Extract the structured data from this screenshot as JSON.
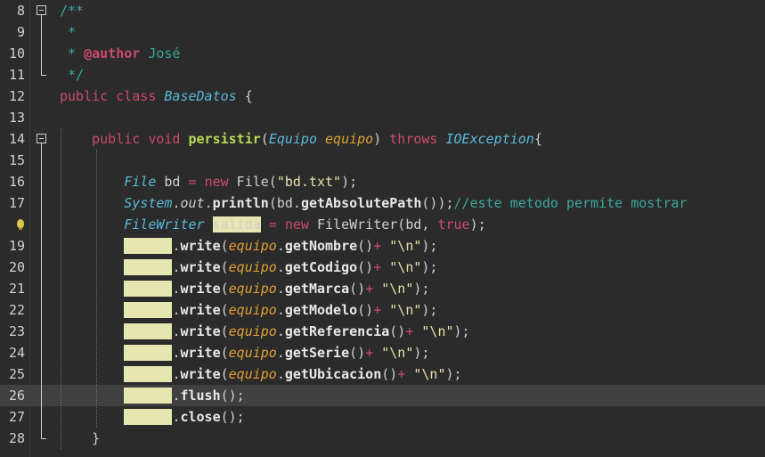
{
  "lines": [
    {
      "n": "8",
      "parts": [
        [
          "cm",
          "/**"
        ]
      ]
    },
    {
      "n": "9",
      "parts": [
        [
          "cm",
          " *"
        ]
      ]
    },
    {
      "n": "10",
      "parts": [
        [
          "cm",
          " * "
        ],
        [
          "tag",
          "@author"
        ],
        [
          "cm",
          " José"
        ]
      ]
    },
    {
      "n": "11",
      "parts": [
        [
          "cm",
          " */"
        ]
      ]
    },
    {
      "n": "12",
      "parts": [
        [
          "kw",
          "public class "
        ],
        [
          "ty",
          "BaseDatos"
        ],
        [
          "cls",
          " {"
        ]
      ]
    },
    {
      "n": "13",
      "parts": []
    },
    {
      "n": "14",
      "parts": [
        [
          "cls",
          "    "
        ],
        [
          "kw",
          "public void "
        ],
        [
          "meth",
          "persistir"
        ],
        [
          "cls",
          "("
        ],
        [
          "ty",
          "Equipo"
        ],
        [
          "cls",
          " "
        ],
        [
          "param",
          "equipo"
        ],
        [
          "cls",
          ") "
        ],
        [
          "kw",
          "throws "
        ],
        [
          "ty",
          "IOException"
        ],
        [
          "cls",
          "{"
        ]
      ]
    },
    {
      "n": "15",
      "parts": []
    },
    {
      "n": "16",
      "parts": [
        [
          "cls",
          "        "
        ],
        [
          "ty",
          "File"
        ],
        [
          "cls",
          " bd "
        ],
        [
          "op",
          "="
        ],
        [
          "cls",
          " "
        ],
        [
          "kw",
          "new"
        ],
        [
          "cls",
          " File("
        ],
        [
          "str",
          "\"bd.txt\""
        ],
        [
          "cls",
          ");"
        ]
      ]
    },
    {
      "n": "17",
      "parts": [
        [
          "cls",
          "        "
        ],
        [
          "ty",
          "System"
        ],
        [
          "cls",
          "."
        ],
        [
          "it",
          "out"
        ],
        [
          "cls",
          "."
        ],
        [
          "call",
          "println"
        ],
        [
          "cls",
          "(bd."
        ],
        [
          "call",
          "getAbsolutePath"
        ],
        [
          "cls",
          "());"
        ],
        [
          "cm",
          "//este metodo permite mostrar"
        ]
      ]
    },
    {
      "n": "",
      "parts": [
        [
          "cls",
          "        "
        ],
        [
          "ty",
          "FileWriter"
        ],
        [
          "cls",
          " "
        ],
        [
          "hl2",
          "salida"
        ],
        [
          "cls",
          " "
        ],
        [
          "op",
          "="
        ],
        [
          "cls",
          " "
        ],
        [
          "kw",
          "new"
        ],
        [
          "cls",
          " FileWriter(bd, "
        ],
        [
          "kw",
          "true"
        ],
        [
          "cls",
          ");"
        ]
      ],
      "bulb": true
    },
    {
      "n": "19",
      "parts": [
        [
          "cls",
          "        "
        ],
        [
          "hl",
          "salida"
        ],
        [
          "cls",
          "."
        ],
        [
          "call",
          "write"
        ],
        [
          "cls",
          "("
        ],
        [
          "param",
          "equipo"
        ],
        [
          "cls",
          "."
        ],
        [
          "call",
          "getNombre"
        ],
        [
          "cls",
          "()"
        ],
        [
          "op",
          "+"
        ],
        [
          "cls",
          " "
        ],
        [
          "str",
          "\"\\n\""
        ],
        [
          "cls",
          ");"
        ]
      ]
    },
    {
      "n": "20",
      "parts": [
        [
          "cls",
          "        "
        ],
        [
          "hl",
          "salida"
        ],
        [
          "cls",
          "."
        ],
        [
          "call",
          "write"
        ],
        [
          "cls",
          "("
        ],
        [
          "param",
          "equipo"
        ],
        [
          "cls",
          "."
        ],
        [
          "call",
          "getCodigo"
        ],
        [
          "cls",
          "()"
        ],
        [
          "op",
          "+"
        ],
        [
          "cls",
          " "
        ],
        [
          "str",
          "\"\\n\""
        ],
        [
          "cls",
          ");"
        ]
      ]
    },
    {
      "n": "21",
      "parts": [
        [
          "cls",
          "        "
        ],
        [
          "hl",
          "salida"
        ],
        [
          "cls",
          "."
        ],
        [
          "call",
          "write"
        ],
        [
          "cls",
          "("
        ],
        [
          "param",
          "equipo"
        ],
        [
          "cls",
          "."
        ],
        [
          "call",
          "getMarca"
        ],
        [
          "cls",
          "()"
        ],
        [
          "op",
          "+"
        ],
        [
          "cls",
          " "
        ],
        [
          "str",
          "\"\\n\""
        ],
        [
          "cls",
          ");"
        ]
      ]
    },
    {
      "n": "22",
      "parts": [
        [
          "cls",
          "        "
        ],
        [
          "hl",
          "salida"
        ],
        [
          "cls",
          "."
        ],
        [
          "call",
          "write"
        ],
        [
          "cls",
          "("
        ],
        [
          "param",
          "equipo"
        ],
        [
          "cls",
          "."
        ],
        [
          "call",
          "getModelo"
        ],
        [
          "cls",
          "()"
        ],
        [
          "op",
          "+"
        ],
        [
          "cls",
          " "
        ],
        [
          "str",
          "\"\\n\""
        ],
        [
          "cls",
          ");"
        ]
      ]
    },
    {
      "n": "23",
      "parts": [
        [
          "cls",
          "        "
        ],
        [
          "hl",
          "salida"
        ],
        [
          "cls",
          "."
        ],
        [
          "call",
          "write"
        ],
        [
          "cls",
          "("
        ],
        [
          "param",
          "equipo"
        ],
        [
          "cls",
          "."
        ],
        [
          "call",
          "getReferencia"
        ],
        [
          "cls",
          "()"
        ],
        [
          "op",
          "+"
        ],
        [
          "cls",
          " "
        ],
        [
          "str",
          "\"\\n\""
        ],
        [
          "cls",
          ");"
        ]
      ]
    },
    {
      "n": "24",
      "parts": [
        [
          "cls",
          "        "
        ],
        [
          "hl",
          "salida"
        ],
        [
          "cls",
          "."
        ],
        [
          "call",
          "write"
        ],
        [
          "cls",
          "("
        ],
        [
          "param",
          "equipo"
        ],
        [
          "cls",
          "."
        ],
        [
          "call",
          "getSerie"
        ],
        [
          "cls",
          "()"
        ],
        [
          "op",
          "+"
        ],
        [
          "cls",
          " "
        ],
        [
          "str",
          "\"\\n\""
        ],
        [
          "cls",
          ");"
        ]
      ]
    },
    {
      "n": "25",
      "parts": [
        [
          "cls",
          "        "
        ],
        [
          "hl",
          "salida"
        ],
        [
          "cls",
          "."
        ],
        [
          "call",
          "write"
        ],
        [
          "cls",
          "("
        ],
        [
          "param",
          "equipo"
        ],
        [
          "cls",
          "."
        ],
        [
          "call",
          "getUbicacion"
        ],
        [
          "cls",
          "()"
        ],
        [
          "op",
          "+"
        ],
        [
          "cls",
          " "
        ],
        [
          "str",
          "\"\\n\""
        ],
        [
          "cls",
          ");"
        ]
      ]
    },
    {
      "n": "26",
      "parts": [
        [
          "cls",
          "        "
        ],
        [
          "hl",
          "salida"
        ],
        [
          "cls",
          "."
        ],
        [
          "call",
          "flush"
        ],
        [
          "cls",
          "();"
        ]
      ],
      "current": true
    },
    {
      "n": "27",
      "parts": [
        [
          "cls",
          "        "
        ],
        [
          "hl",
          "salida"
        ],
        [
          "cls",
          "."
        ],
        [
          "call",
          "close"
        ],
        [
          "cls",
          "();"
        ]
      ]
    },
    {
      "n": "28",
      "parts": [
        [
          "cls",
          "    }"
        ]
      ]
    }
  ]
}
